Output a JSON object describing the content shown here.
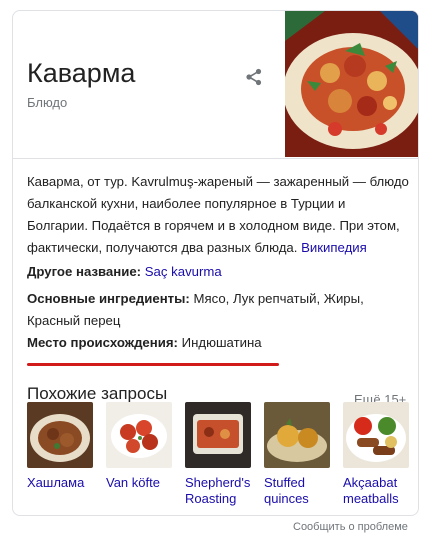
{
  "entity": {
    "title": "Каварма",
    "subtitle": "Блюдо",
    "share_icon": "share-icon"
  },
  "description": {
    "text": "Каварма, от тур. Kavrulmuş-жареный — зажаренный — блюдо балканской кухни, наиболее популярное в Турции и Болгарии. Подаётся в горячем и в холодном виде. При этом, фактически, получаются два разных блюда.",
    "source_link": "Википедия"
  },
  "facts": [
    {
      "label": "Другое название:",
      "value": "Saç kavurma",
      "value_is_link": true
    },
    {
      "label": "Основные ингредиенты:",
      "value": "Мясо, Лук репчатый, Жиры, Красный перец",
      "value_is_link": false
    },
    {
      "label": "Место происхождения:",
      "value": "Индюшатина",
      "value_is_link": false
    }
  ],
  "related": {
    "title": "Похожие запросы",
    "more_label": "Ещё 15+",
    "items": [
      {
        "label": "Хашлама"
      },
      {
        "label": "Van köfte"
      },
      {
        "label": "Shepherd's Roasting"
      },
      {
        "label": "Stuffed quinces"
      },
      {
        "label": "Akçaabat meatballs"
      }
    ]
  },
  "footer": {
    "report_label": "Сообщить о проблеме"
  },
  "colors": {
    "link": "#1a0dab",
    "muted": "#70757a",
    "annotation_underline": "#d11a1a"
  }
}
